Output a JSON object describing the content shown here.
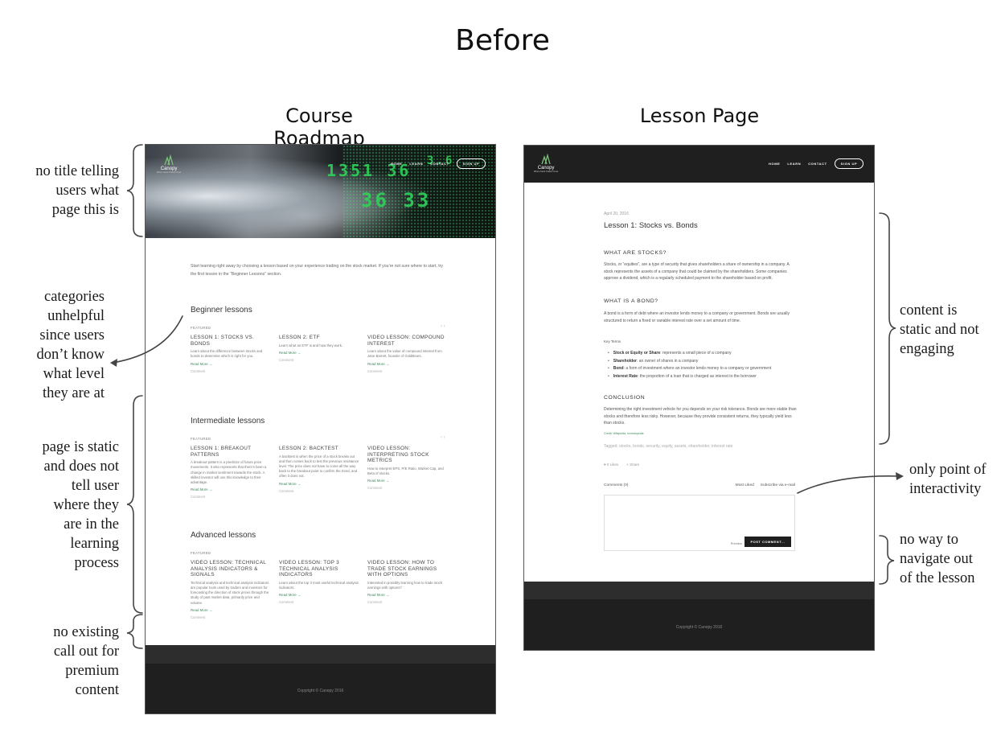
{
  "page": {
    "title": "Before",
    "left_title": "Course Roadmap",
    "right_title": "Lesson Page"
  },
  "annotations": {
    "no_title": [
      "no title telling",
      "users what",
      "page this is"
    ],
    "categories": [
      "categories",
      "unhelpful",
      "since users",
      "don’t know",
      "what level",
      "they are at"
    ],
    "static_page": [
      "page is static",
      "and does not",
      "tell user",
      "where they",
      "are in the",
      "learning",
      "process"
    ],
    "premium": [
      "no existing",
      "call out for",
      "premium",
      "content"
    ],
    "content_static": [
      "content is",
      "static and not",
      "engaging"
    ],
    "interactivity": [
      "only point of",
      "interactivity"
    ],
    "navigate": [
      "no way to",
      "navigate out",
      "of the lesson"
    ]
  },
  "site": {
    "logo_name": "Canopy",
    "logo_tagline": "Where Stock Traders Grow",
    "nav": [
      "HOME",
      "LEARN",
      "CONTACT"
    ],
    "signup": "SIGN UP",
    "copyright": "Copyright © Canopy 2016"
  },
  "roadmap": {
    "intro": "Start learning right away by choosing a lesson based on your experience trading on the stock market. If you’re not sure where to start, try the first lesson in the “Beginner Lessons” section.",
    "featured_label": "FEATURED",
    "read_more": "Read More →",
    "comment": "Comment",
    "sections": [
      {
        "title": "Beginner lessons",
        "cards": [
          {
            "title": "LESSON 1: STOCKS VS. BONDS",
            "desc": "Learn about the difference between stocks and bonds to determine which is right for you."
          },
          {
            "title": "LESSON 2: ETF",
            "desc": "Learn what an ETF is and how they work."
          },
          {
            "title": "VIDEO LESSON: COMPOUND INTEREST",
            "desc": "Learn about the value of compound interest from Jane Barrett, founder of GoldBears."
          }
        ]
      },
      {
        "title": "Intermediate lessons",
        "cards": [
          {
            "title": "LESSON 1: BREAKOUT PATTERNS",
            "desc": "A breakout pattern is a predictor of future price movements. It also represents that there’s been a change in market sentiment towards the stock. A skilled investor will use this knowledge to their advantage."
          },
          {
            "title": "LESSON 2: BACKTEST",
            "desc": "A backtest is when the price of a stock breaks out and then comes back to test the previous resistance level. The price does not have to come all the way back to the breakout point to confirm the trend, and often it does not."
          },
          {
            "title": "VIDEO LESSON: INTERPRETING STOCK METRICS",
            "desc": "How to interpret EPS, P/E Ratio, Market Cap, and Beta of stocks."
          }
        ]
      },
      {
        "title": "Advanced lessons",
        "cards": [
          {
            "title": "VIDEO LESSON: TECHNICAL ANALYSIS INDICATORS & SIGNALS",
            "desc": "Technical analysis and technical analysis indicators are popular tools used by traders and investors for forecasting the direction of stock prices through the study of past market data, primarily price and volume."
          },
          {
            "title": "VIDEO LESSON: TOP 3 TECHNICAL ANALYSIS INDICATORS",
            "desc": "Learn about the top 3 most useful technical analysis indicators."
          },
          {
            "title": "VIDEO LESSON: HOW TO TRADE STOCK EARNINGS WITH OPTIONS",
            "desc": "Interested in possibly learning how to trade stock earnings with options?"
          }
        ]
      }
    ]
  },
  "lesson": {
    "date": "April 20, 2016",
    "title": "Lesson 1: Stocks vs. Bonds",
    "h1": "WHAT ARE STOCKS?",
    "p1": "Stocks, or “equities”, are a type of security that gives shareholders a share of ownership in a company. A stock represents the assets of a company that could be claimed by the shareholders. Some companies approve a dividend, which is a regularly scheduled payment to the shareholder based on profit.",
    "h2": "WHAT IS A BOND?",
    "p2": "A bond is a form of debt where an investor lends money to a company or government. Bonds are usually structured to return a fixed or variable interest rate over a set amount of time.",
    "key_terms": "Key Terms",
    "terms": [
      {
        "term": "Stock or Equity or Share",
        "def": ": represents a small piece of a company"
      },
      {
        "term": "Shareholder",
        "def": ": an owner of shares in a company"
      },
      {
        "term": "Bond",
        "def": ": a form of investment where an investor lends money to a company or government"
      },
      {
        "term": "Interest Rate",
        "def": ": the proportion of a loan that is charged as interest to the borrower"
      }
    ],
    "h3": "CONCLUSION",
    "p3": "Determining the right investment vehicle for you depends on your risk tolerance. Bonds are more stable than stocks and therefore less risky. However, because they provide consistent returns, they typically yield less than stocks.",
    "credit": "Credit: Wikipedia, Investopedia",
    "tags": "Tagged: stocks, bonds, security, equity, assets, shareholder, interest rate",
    "likes": "♥ 0 Likes",
    "share": "< Share",
    "comments_label": "Comments (0)",
    "most_liked": "Most Liked",
    "subscribe": "Subscribe via e-mail",
    "preview": "Preview",
    "post_comment": "POST COMMENT..."
  }
}
